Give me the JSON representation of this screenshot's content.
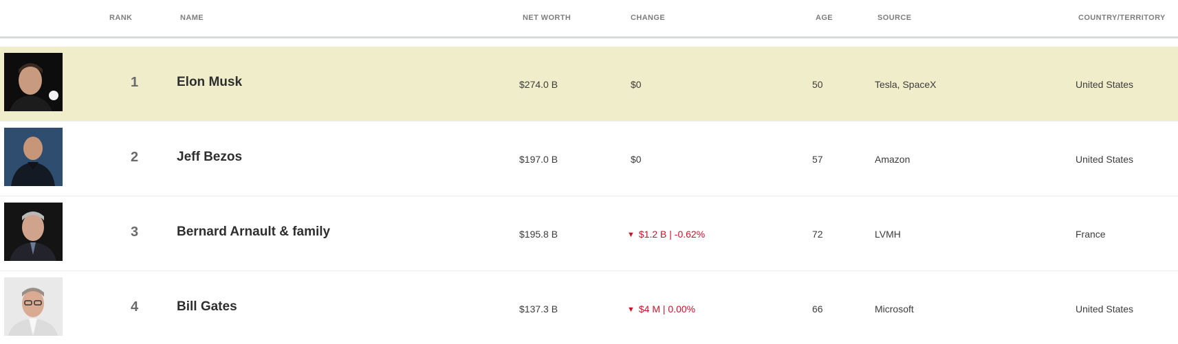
{
  "columns": {
    "rank": "RANK",
    "name": "NAME",
    "net_worth": "NET WORTH",
    "change": "CHANGE",
    "age": "AGE",
    "source": "SOURCE",
    "country": "COUNTRY/TERRITORY"
  },
  "rows": [
    {
      "rank": "1",
      "name": "Elon Musk",
      "net_worth": "$274.0 B",
      "change": "$0",
      "change_direction": "none",
      "age": "50",
      "source": "Tesla, SpaceX",
      "country": "United States",
      "highlighted": true
    },
    {
      "rank": "2",
      "name": "Jeff Bezos",
      "net_worth": "$197.0 B",
      "change": "$0",
      "change_direction": "none",
      "age": "57",
      "source": "Amazon",
      "country": "United States",
      "highlighted": false
    },
    {
      "rank": "3",
      "name": "Bernard Arnault & family",
      "net_worth": "$195.8 B",
      "change": "$1.2 B | -0.62%",
      "change_direction": "down",
      "age": "72",
      "source": "LVMH",
      "country": "France",
      "highlighted": false
    },
    {
      "rank": "4",
      "name": "Bill Gates",
      "net_worth": "$137.3 B",
      "change": "$4 M | 0.00%",
      "change_direction": "down",
      "age": "66",
      "source": "Microsoft",
      "country": "United States",
      "highlighted": false
    }
  ],
  "colors": {
    "highlight_row": "#f0edca",
    "negative_change": "#d0102a",
    "header_text": "#7d7d7d"
  },
  "icons": {
    "down": "triangle-down-icon"
  }
}
